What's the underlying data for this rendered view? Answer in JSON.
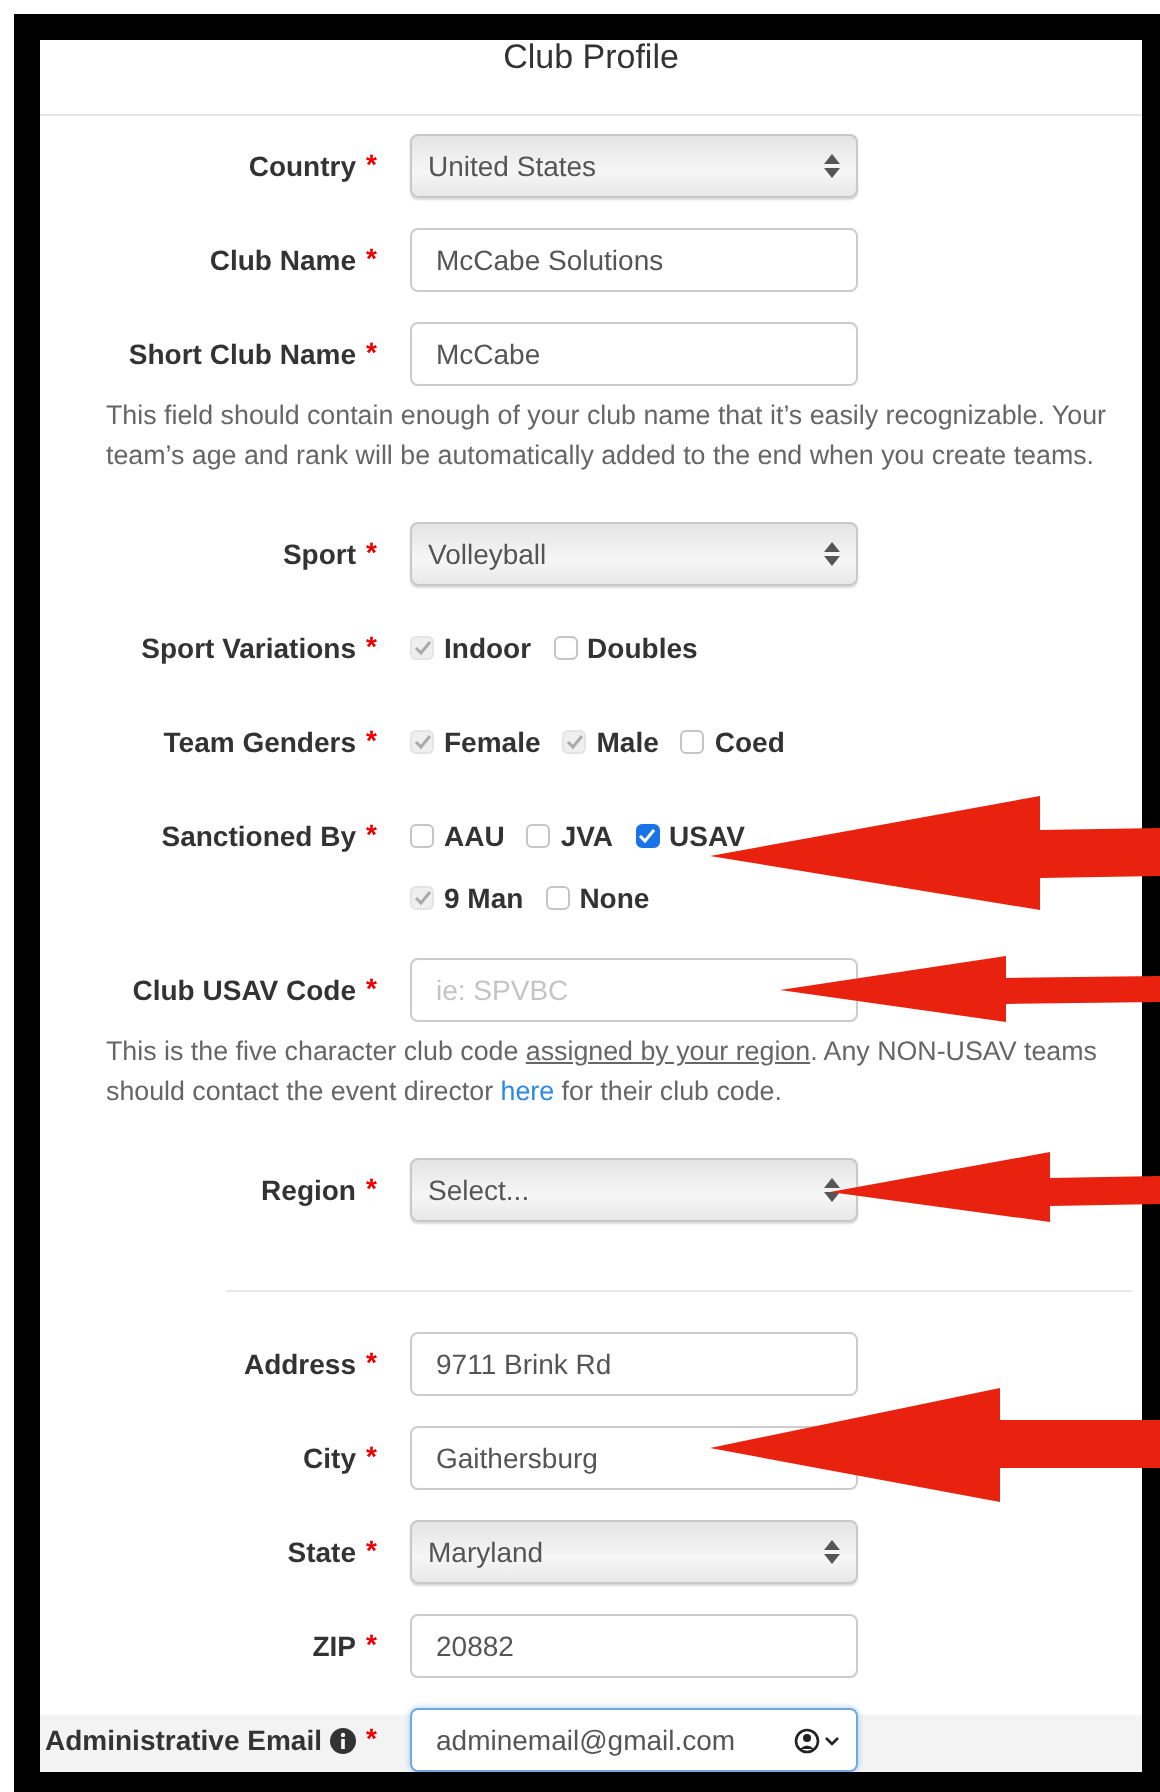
{
  "title": "Club Profile",
  "required_mark": "*",
  "rows": [
    {
      "kind": "select",
      "label": "Country",
      "required": true,
      "value": "United States"
    },
    {
      "kind": "text",
      "label": "Club Name",
      "required": true,
      "value": "McCabe Solutions"
    },
    {
      "kind": "text",
      "label": "Short Club Name",
      "required": true,
      "value": "McCabe"
    },
    {
      "kind": "help",
      "parts": [
        {
          "kind": "plain",
          "text": "This field should contain enough of your club name that it’s easily recognizable. Your team’s age and rank will be automatically added to the end when you create teams."
        }
      ]
    },
    {
      "kind": "select",
      "label": "Sport",
      "required": true,
      "value": "Volleyball"
    },
    {
      "kind": "checkboxes",
      "label": "Sport Variations",
      "required": true,
      "lines": [
        [
          {
            "label": "Indoor",
            "checked": true,
            "disabled": true
          },
          {
            "label": "Doubles",
            "checked": false,
            "disabled": false
          }
        ]
      ]
    },
    {
      "kind": "checkboxes",
      "label": "Team Genders",
      "required": true,
      "lines": [
        [
          {
            "label": "Female",
            "checked": true,
            "disabled": true
          },
          {
            "label": "Male",
            "checked": true,
            "disabled": true
          },
          {
            "label": "Coed",
            "checked": false,
            "disabled": false
          }
        ]
      ]
    },
    {
      "kind": "checkboxes",
      "label": "Sanctioned By",
      "required": true,
      "lines": [
        [
          {
            "label": "AAU",
            "checked": false,
            "disabled": false
          },
          {
            "label": "JVA",
            "checked": false,
            "disabled": false
          },
          {
            "label": "USAV",
            "checked": true,
            "disabled": false
          }
        ],
        [
          {
            "label": "9 Man",
            "checked": true,
            "disabled": true
          },
          {
            "label": "None",
            "checked": false,
            "disabled": false
          }
        ]
      ]
    },
    {
      "kind": "text",
      "label": "Club USAV Code",
      "required": true,
      "placeholder": "ie: SPVBC"
    },
    {
      "kind": "help",
      "parts": [
        {
          "kind": "plain",
          "text": "This is the five character club code "
        },
        {
          "kind": "underline",
          "text": "assigned by your region"
        },
        {
          "kind": "plain",
          "text": ". Any NON-USAV teams should contact the event director "
        },
        {
          "kind": "link",
          "text": "here"
        },
        {
          "kind": "plain",
          "text": " for their club code."
        }
      ]
    },
    {
      "kind": "select",
      "label": "Region",
      "required": true,
      "value": "Select..."
    },
    {
      "kind": "divider"
    },
    {
      "kind": "text",
      "label": "Address",
      "required": true,
      "value": "9711 Brink Rd"
    },
    {
      "kind": "text",
      "label": "City",
      "required": true,
      "value": "Gaithersburg"
    },
    {
      "kind": "select",
      "label": "State",
      "required": true,
      "value": "Maryland"
    },
    {
      "kind": "text",
      "label": "ZIP",
      "required": true,
      "value": "20882"
    },
    {
      "kind": "email",
      "label": "Administrative Email",
      "required": true,
      "info": true,
      "focused": true,
      "autofill": true,
      "value": "adminemail@gmail.com"
    }
  ]
}
